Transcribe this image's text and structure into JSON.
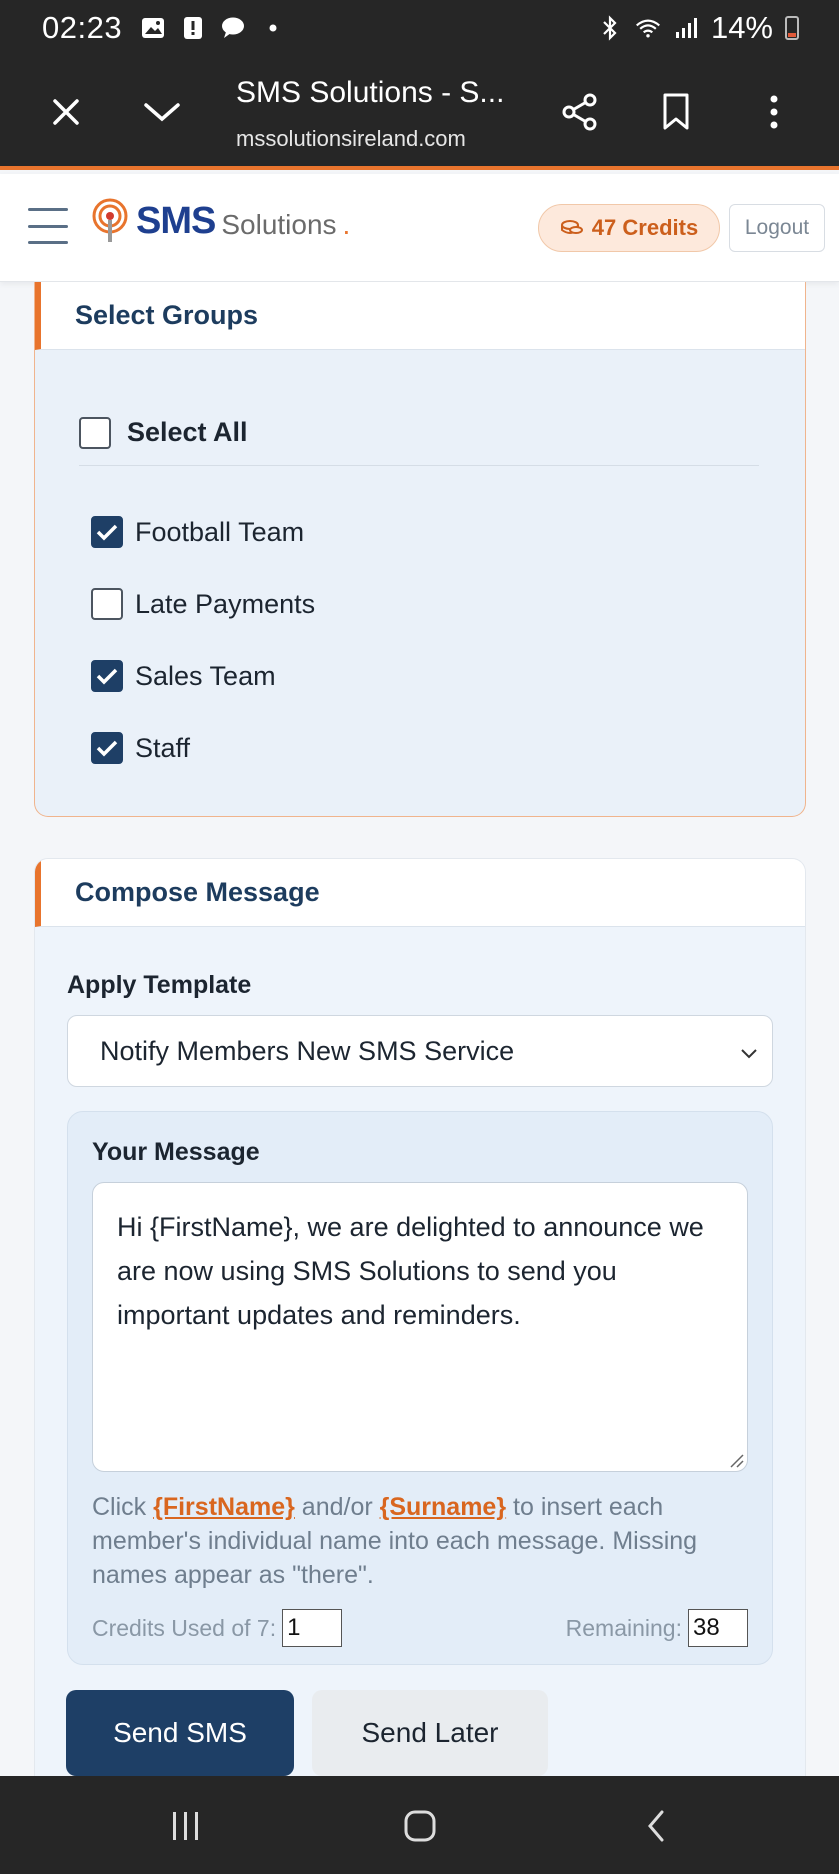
{
  "status_bar": {
    "time": "02:23",
    "battery": "14%"
  },
  "browser": {
    "title": "SMS Solutions - S...",
    "url": "mssolutionsireland.com"
  },
  "header": {
    "logo_main": "SMS",
    "logo_sub": "Solutions",
    "logo_dot": ".",
    "credits": "47 Credits",
    "logout": "Logout"
  },
  "groups": {
    "title": "Select Groups",
    "select_all": "Select All",
    "items": [
      {
        "label": "Football Team",
        "checked": true
      },
      {
        "label": "Late Payments",
        "checked": false
      },
      {
        "label": "Sales Team",
        "checked": true
      },
      {
        "label": "Staff",
        "checked": true
      }
    ]
  },
  "compose": {
    "title": "Compose Message",
    "template_label": "Apply Template",
    "template_value": "Notify Members New SMS Service",
    "message_label": "Your Message",
    "message_text": "Hi {FirstName}, we are delighted to announce we are now using SMS Solutions to send you important updates and reminders.",
    "help_click": "Click ",
    "help_firstname": "{FirstName}",
    "help_andor": " and/or ",
    "help_surname": "{Surname}",
    "help_rest": " to insert each member's individual name into each message. Missing names appear as \"there\".",
    "credits_used_label": "Credits Used of 7:",
    "credits_used_value": "1",
    "remaining_label": "Remaining:",
    "remaining_value": "38",
    "send_button": "Send SMS",
    "send_later_button": "Send Later"
  },
  "colors": {
    "accent": "#e8742d",
    "primary": "#1e3f66"
  }
}
